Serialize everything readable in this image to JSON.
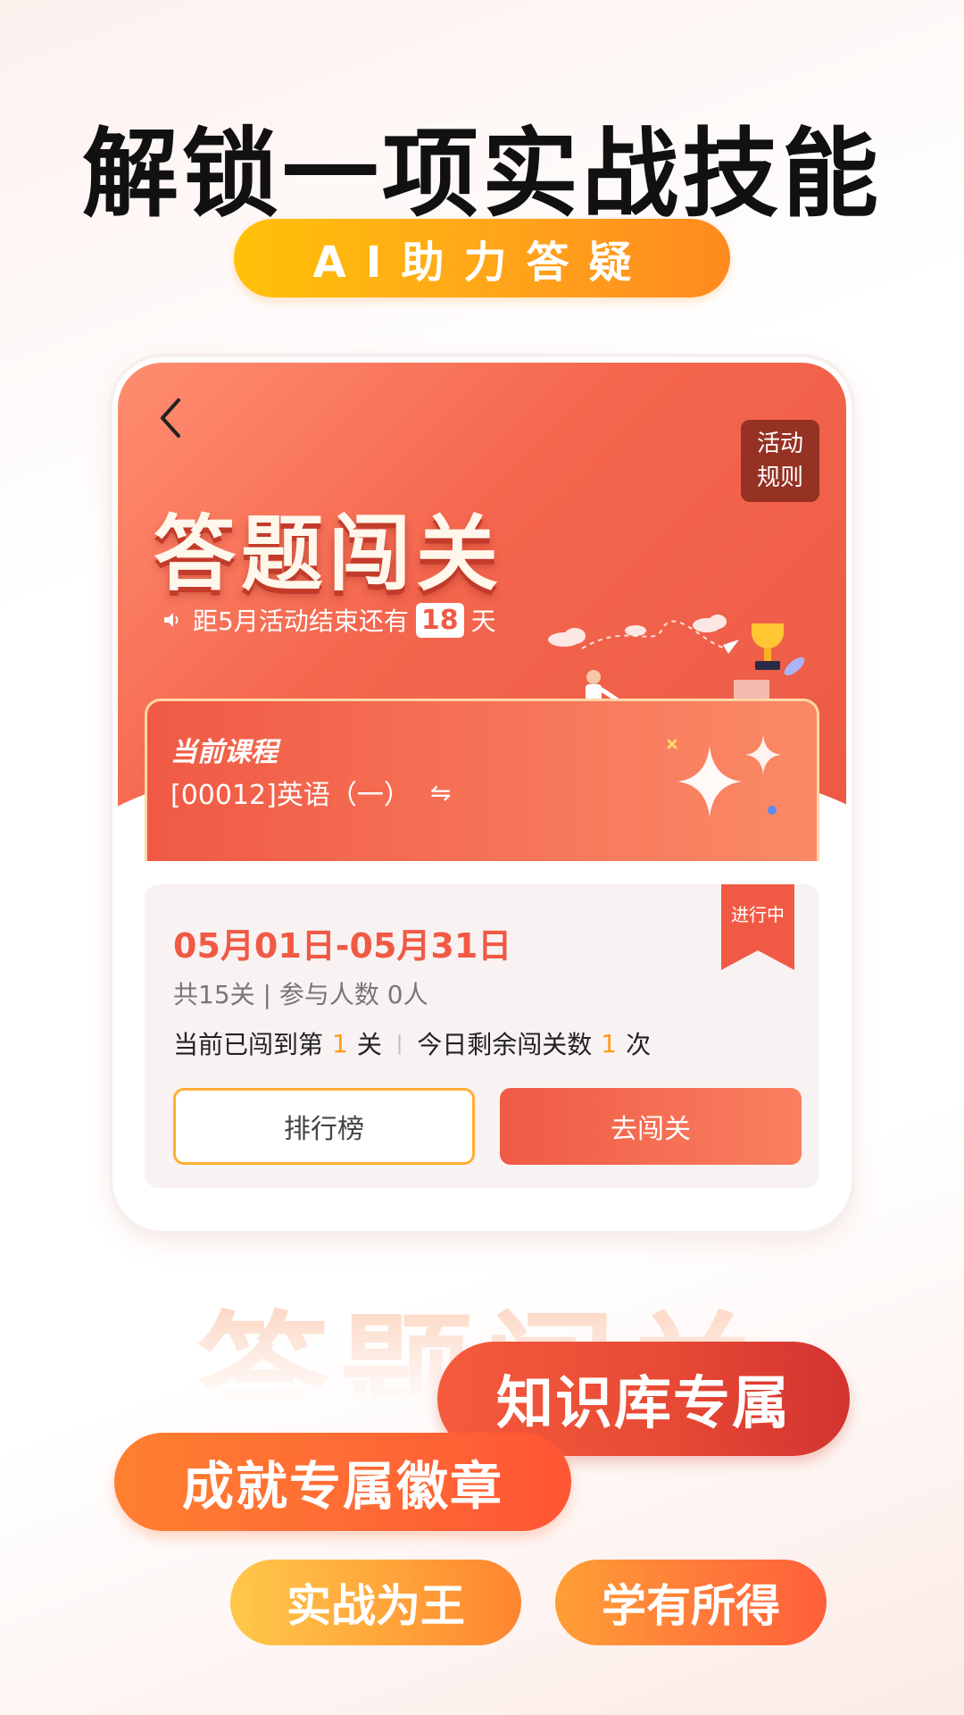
{
  "headline": "解锁一项实战技能",
  "subtitle_pill": "AI助力答疑",
  "phone": {
    "rules_button": [
      "活动",
      "规则"
    ],
    "hero_title": "答题闯关",
    "countdown": {
      "prefix": "距5月活动结束还有",
      "days": "18",
      "suffix": "天"
    },
    "course": {
      "label": "当前课程",
      "name": "[00012]英语（一）",
      "swap_icon": "⇋"
    },
    "info": {
      "status": "进行中",
      "date_range": "05月01日-05月31日",
      "levels": "共15关 | 参与人数 0人",
      "progress_prefix": "当前已闯到第",
      "progress_level": "1",
      "progress_unit": "关",
      "remaining_prefix": "今日剩余闯关数",
      "remaining_count": "1",
      "remaining_unit": "次",
      "rank_button": "排行榜",
      "go_button": "去闯关"
    }
  },
  "ghost_title": "答题闯关",
  "tags": {
    "knowledge": "知识库专属",
    "badge": "成就专属徽章",
    "combat": "实战为王",
    "gain": "学有所得"
  },
  "colors": {
    "primary": "#f05a45",
    "accent_yellow": "#ffa41a",
    "highlight": "#ff9b1a"
  },
  "icons": {
    "back": "chevron-left-icon",
    "speaker": "speaker-icon",
    "swap": "swap-icon"
  }
}
